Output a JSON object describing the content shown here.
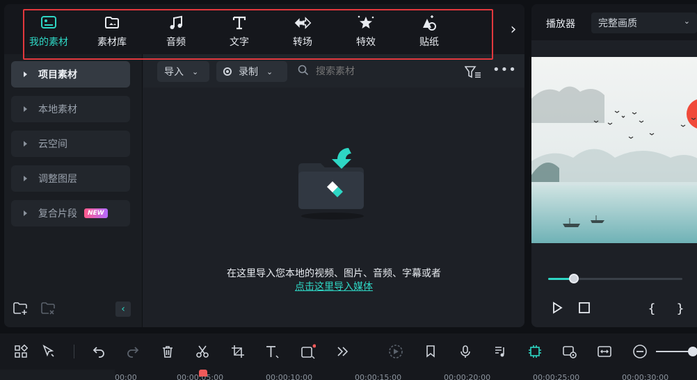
{
  "media_tabs": [
    {
      "label": "我的素材",
      "icon": "my-media-icon",
      "active": true
    },
    {
      "label": "素材库",
      "icon": "stock-media-icon",
      "active": false
    },
    {
      "label": "音频",
      "icon": "audio-icon",
      "active": false
    },
    {
      "label": "文字",
      "icon": "text-icon",
      "active": false
    },
    {
      "label": "转场",
      "icon": "transition-icon",
      "active": false
    },
    {
      "label": "特效",
      "icon": "effects-icon",
      "active": false
    },
    {
      "label": "贴纸",
      "icon": "sticker-icon",
      "active": false
    }
  ],
  "sidebar": {
    "items": [
      {
        "label": "项目素材",
        "active": true
      },
      {
        "label": "本地素材",
        "active": false
      },
      {
        "label": "云空间",
        "active": false
      },
      {
        "label": "调整图层",
        "active": false
      },
      {
        "label": "复合片段",
        "active": false,
        "badge": "NEW"
      }
    ]
  },
  "content_toolbar": {
    "import_label": "导入",
    "record_label": "录制",
    "search_placeholder": "搜索素材"
  },
  "empty_state": {
    "message": "在这里导入您本地的视频、图片、音频、字幕或者",
    "link": "点击这里导入媒体"
  },
  "player": {
    "title": "播放器",
    "quality": "完整画质",
    "progress": 0.19,
    "brace_open": "{",
    "brace_close": "}"
  },
  "timeline": {
    "ticks": [
      "00:00",
      "00:00:05:00",
      "00:00:10:00",
      "00:00:15:00",
      "00:00:20:00",
      "00:00:25:00",
      "00:00:30:00"
    ]
  },
  "colors": {
    "accent": "#2ed6c4",
    "highlight_border": "#e2383d",
    "playhead": "#f05a5a"
  }
}
